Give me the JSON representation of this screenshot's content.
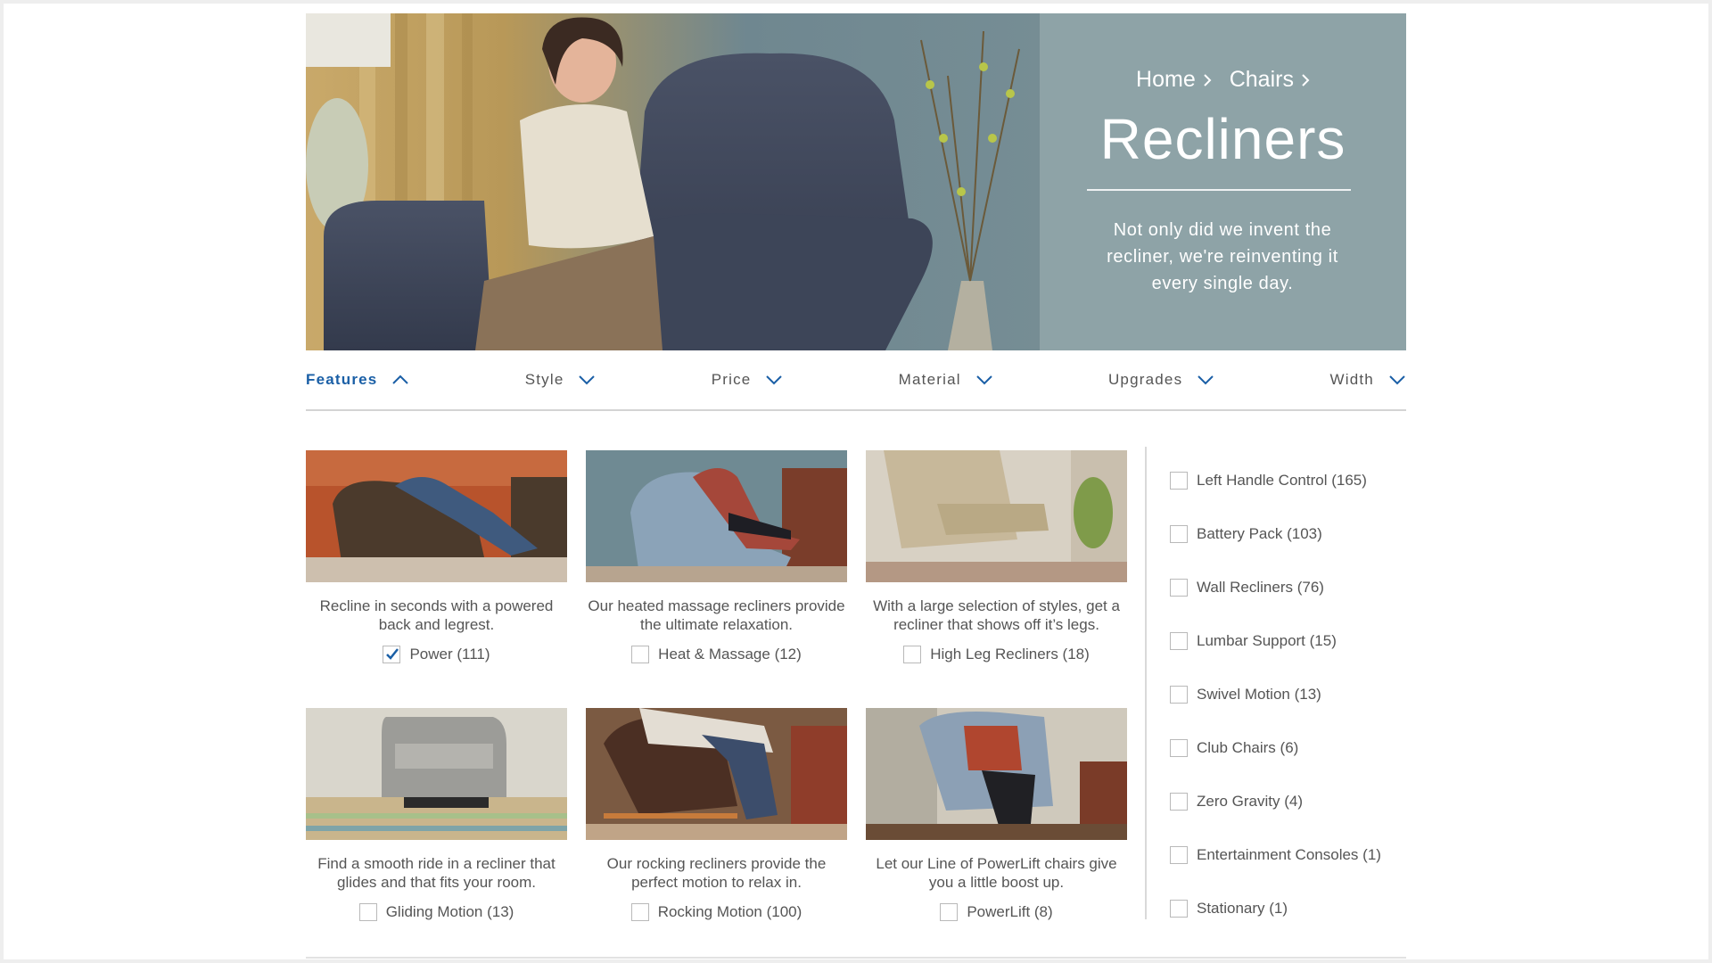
{
  "hero": {
    "breadcrumbs": [
      "Home",
      "Chairs"
    ],
    "title": "Recliners",
    "tagline": "Not only did we invent the recliner, we're reinventing it every single day."
  },
  "filters": [
    {
      "label": "Features",
      "active": true
    },
    {
      "label": "Style",
      "active": false
    },
    {
      "label": "Price",
      "active": false
    },
    {
      "label": "Material",
      "active": false
    },
    {
      "label": "Upgrades",
      "active": false
    },
    {
      "label": "Width",
      "active": false
    }
  ],
  "features": [
    {
      "desc": "Recline in seconds with a powered back and legrest.",
      "label": "Power (111)",
      "checked": true
    },
    {
      "desc": "Our heated massage recliners provide the ultimate relaxation.",
      "label": "Heat & Massage (12)",
      "checked": false
    },
    {
      "desc": "With a large selection of styles, get a recliner that shows off it’s legs.",
      "label": "High Leg Recliners (18)",
      "checked": false
    },
    {
      "desc": "Find a smooth ride in a recliner that glides and that fits your room.",
      "label": "Gliding Motion (13)",
      "checked": false
    },
    {
      "desc": "Our rocking recliners provide the perfect motion to relax in.",
      "label": "Rocking Motion (100)",
      "checked": false
    },
    {
      "desc": "Let our Line of PowerLift chairs give you a little boost up.",
      "label": "PowerLift (8)",
      "checked": false
    }
  ],
  "side_options": [
    "Left Handle Control (165)",
    "Battery Pack (103)",
    "Wall Recliners (76)",
    "Lumbar Support (15)",
    "Swivel Motion (13)",
    "Club Chairs (6)",
    "Zero Gravity (4)",
    "Entertainment Consoles (1)",
    "Stationary (1)"
  ],
  "colors": {
    "accent": "#1a5fa6",
    "hero_panel": "#8ea3a7",
    "text": "#555555",
    "rule": "#d4d4d4"
  }
}
